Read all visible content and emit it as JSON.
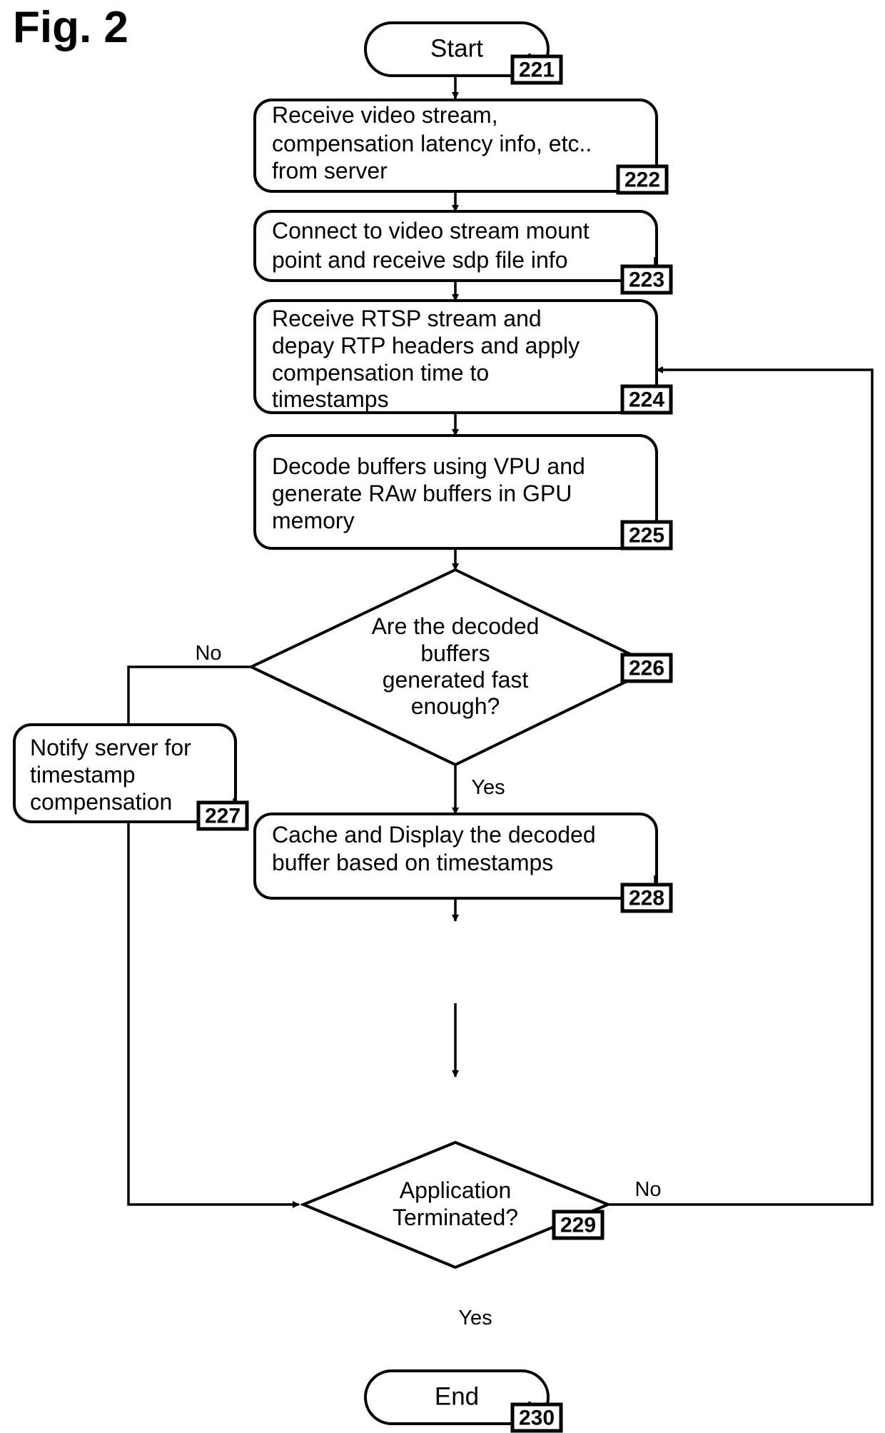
{
  "figure": {
    "label": "Fig. 2"
  },
  "diagram": {
    "type": "flowchart",
    "nodes": [
      {
        "id": "start",
        "ref": "221",
        "shape": "terminator",
        "lines": [
          "Start"
        ]
      },
      {
        "id": "receive-video-stream",
        "ref": "222",
        "shape": "process",
        "lines": [
          "Receive video stream,",
          "compensation latency info, etc..",
          "from server"
        ]
      },
      {
        "id": "connect-mount-point",
        "ref": "223",
        "shape": "process",
        "lines": [
          "Connect to video stream mount",
          "point and receive sdp file info"
        ]
      },
      {
        "id": "receive-rtsp-stream",
        "ref": "224",
        "shape": "process",
        "lines": [
          "Receive RTSP stream and",
          "depay RTP headers and apply",
          "compensation time to",
          "timestamps"
        ]
      },
      {
        "id": "decode-buffers",
        "ref": "225",
        "shape": "process",
        "lines": [
          "Decode buffers using VPU and",
          "generate RAw buffers in GPU",
          "memory"
        ]
      },
      {
        "id": "buffers-fast-enough",
        "ref": "226",
        "shape": "decision",
        "lines": [
          "Are the decoded",
          "buffers",
          "generated fast",
          "enough?"
        ]
      },
      {
        "id": "notify-server",
        "ref": "227",
        "shape": "process",
        "lines": [
          "Notify server for",
          "timestamp",
          "compensation"
        ]
      },
      {
        "id": "cache-and-display",
        "ref": "228",
        "shape": "process",
        "lines": [
          "Cache and Display the decoded",
          "buffer based on timestamps"
        ]
      },
      {
        "id": "application-terminated",
        "ref": "229",
        "shape": "decision",
        "lines": [
          "Application",
          "Terminated?"
        ]
      },
      {
        "id": "end",
        "ref": "230",
        "shape": "terminator",
        "lines": [
          "End"
        ]
      }
    ],
    "branch_labels": {
      "decision226_no": "No",
      "decision226_yes": "Yes",
      "decision229_no": "No",
      "decision229_yes": "Yes"
    },
    "colors": {
      "stroke": "#000000",
      "fill": "#ffffff",
      "text": "#000000"
    }
  }
}
